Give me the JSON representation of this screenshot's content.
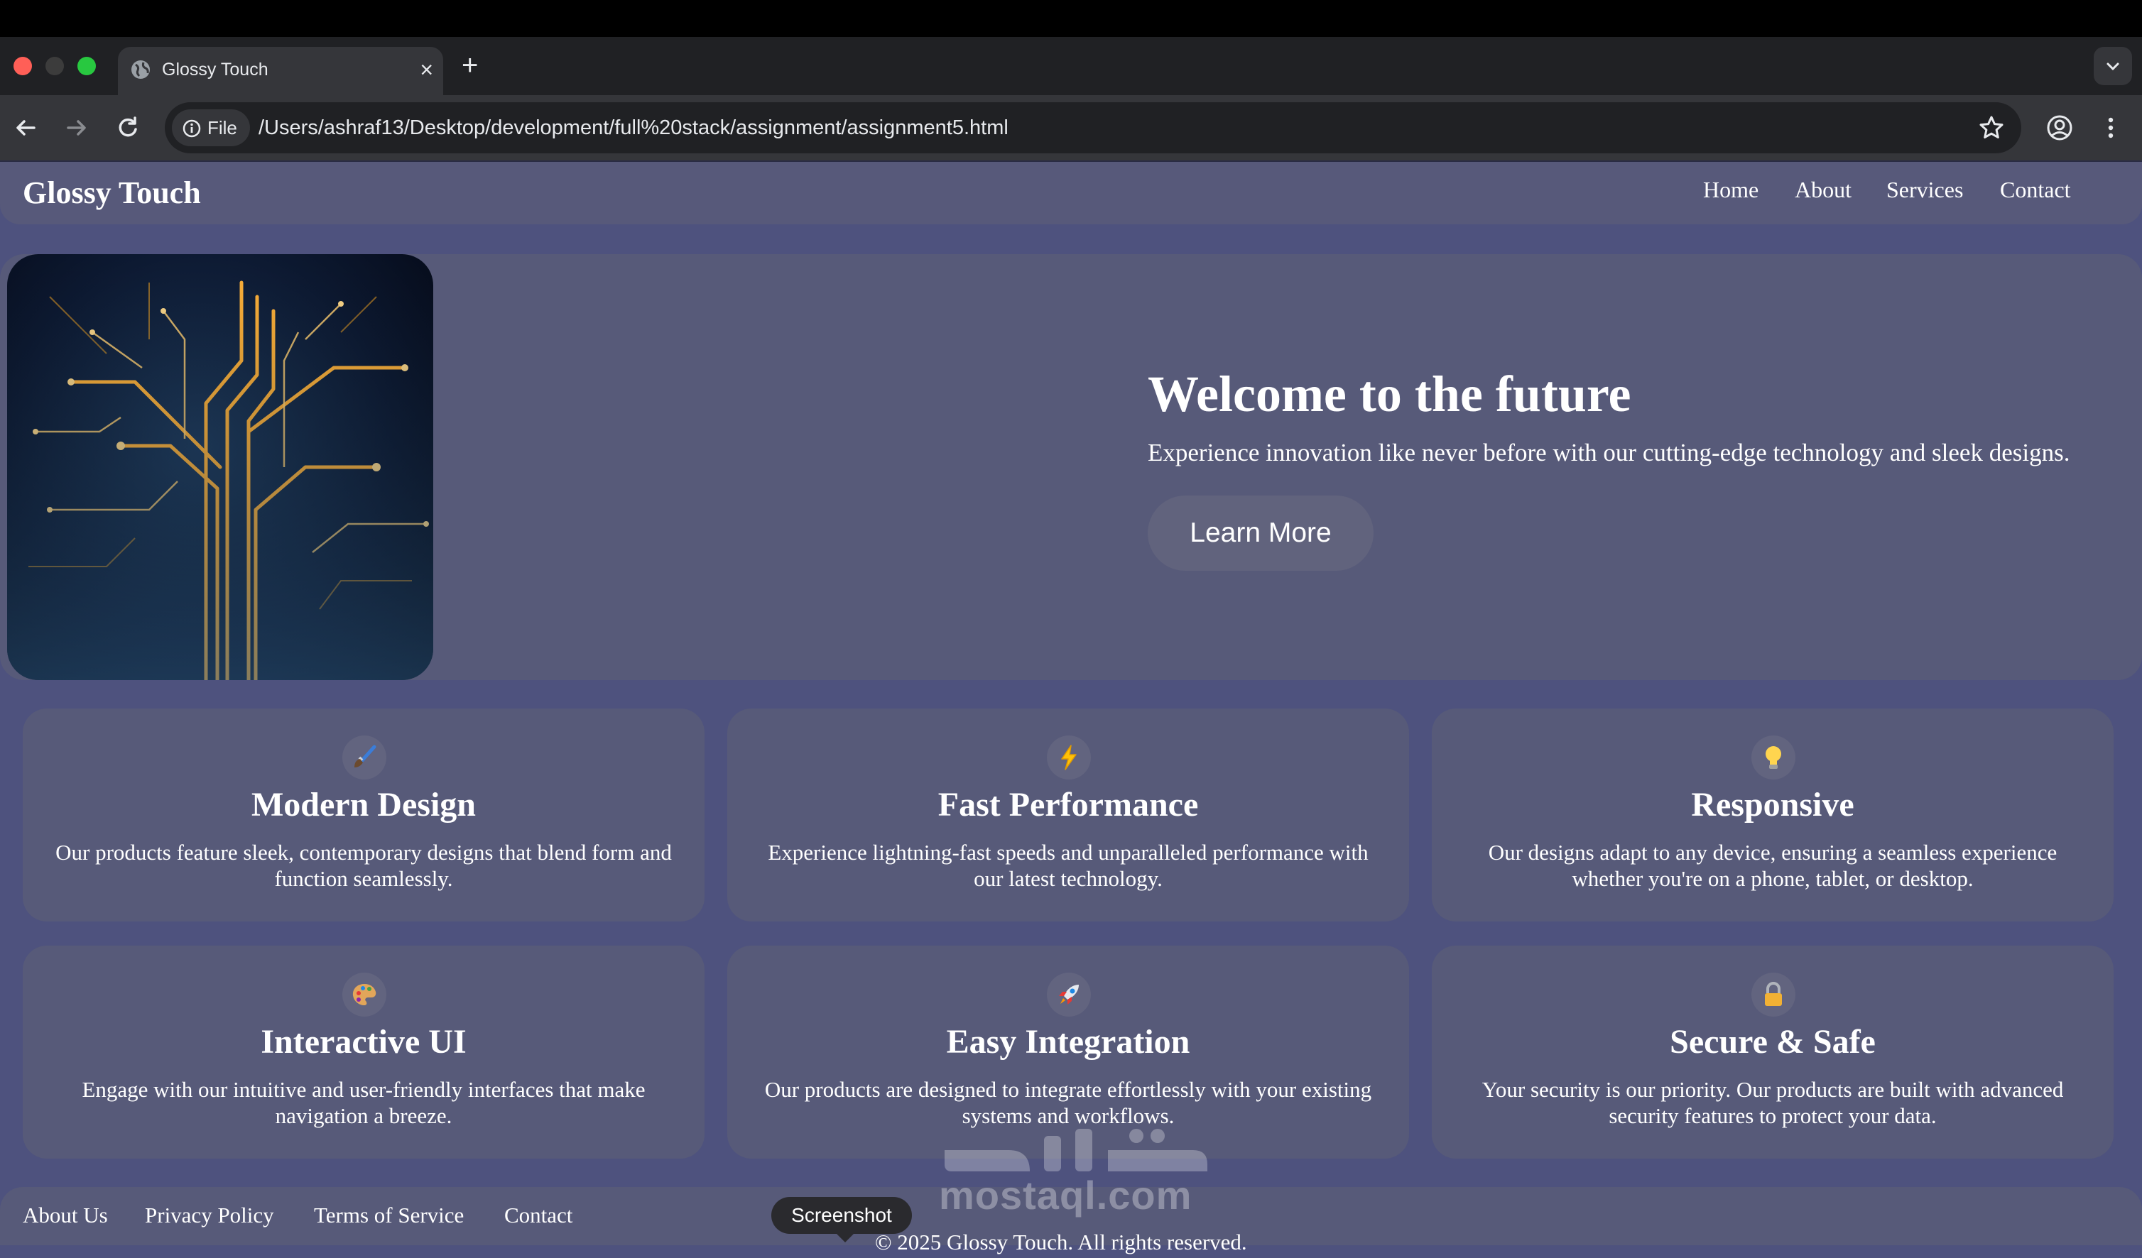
{
  "browser": {
    "tab_title": "Glossy Touch",
    "new_tab_symbol": "+",
    "close_symbol": "×",
    "scheme_chip": "File",
    "url": "/Users/ashraf13/Desktop/development/full%20stack/assignment/assignment5.html"
  },
  "page": {
    "brand": "Glossy Touch",
    "nav": [
      "Home",
      "About",
      "Services",
      "Contact"
    ],
    "hero": {
      "title": "Welcome to the future",
      "subtitle": "Experience innovation like never before with our cutting-edge technology and sleek designs.",
      "button": "Learn More"
    },
    "features": [
      {
        "icon": "paintbrush-icon",
        "title": "Modern Design",
        "desc": "Our products feature sleek, contemporary designs that blend form and function seamlessly."
      },
      {
        "icon": "lightning-icon",
        "title": "Fast Performance",
        "desc": "Experience lightning-fast speeds and unparalleled performance with our latest technology."
      },
      {
        "icon": "lightbulb-icon",
        "title": "Responsive",
        "desc": "Our designs adapt to any device, ensuring a seamless experience whether you're on a phone, tablet, or desktop."
      },
      {
        "icon": "palette-icon",
        "title": "Interactive UI",
        "desc": "Engage with our intuitive and user-friendly interfaces that make navigation a breeze."
      },
      {
        "icon": "rocket-icon",
        "title": "Easy Integration",
        "desc": "Our products are designed to integrate effortlessly with your existing systems and workflows."
      },
      {
        "icon": "lock-icon",
        "title": "Secure & Safe",
        "desc": "Your security is our priority. Our products are built with advanced security features to protect your data."
      }
    ],
    "footer": {
      "links": [
        "About Us",
        "Privacy Policy",
        "Terms of Service",
        "Contact"
      ],
      "copyright": "© 2025 Glossy Touch. All rights reserved."
    }
  },
  "overlay": {
    "tooltip": "Screenshot",
    "watermark": "mostaql.com"
  },
  "colors": {
    "page_bg": "#4e527e",
    "panel_bg": "#575a79",
    "accent_gold": "#ffb23a"
  }
}
